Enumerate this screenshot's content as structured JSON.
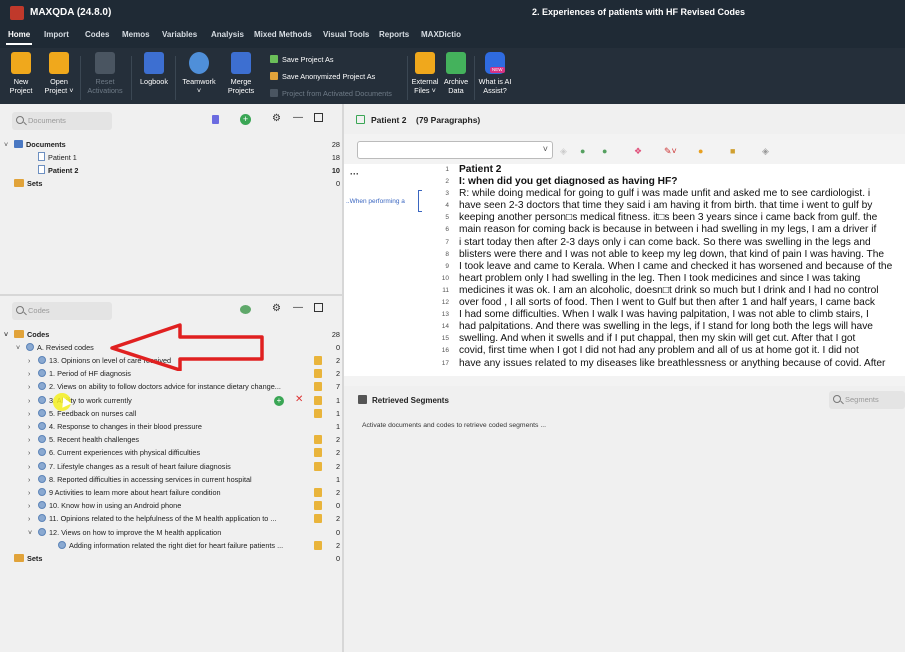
{
  "app_title": "MAXQDA (24.8.0)",
  "doc_title": "2. Experiences of patients with HF Revised Codes",
  "menu": [
    "Home",
    "Import",
    "Codes",
    "Memos",
    "Variables",
    "Analysis",
    "Mixed Methods",
    "Visual Tools",
    "Reports",
    "MAXDictio"
  ],
  "ribbon": {
    "new_project": [
      "New",
      "Project"
    ],
    "open_project": [
      "Open",
      "Project"
    ],
    "reset_activations": [
      "Reset",
      "Activations"
    ],
    "logbook": "Logbook",
    "teamwork": "Teamwork",
    "merge_projects": [
      "Merge",
      "Projects"
    ],
    "save_project_as": "Save Project As",
    "save_anonymized": "Save Anonymized Project As",
    "project_from_activated": "Project from Activated Documents",
    "external_files": [
      "External",
      "Files"
    ],
    "archive_data": [
      "Archive",
      "Data"
    ],
    "what_is_ai": [
      "What is AI",
      "Assist?"
    ],
    "new_badge": "NEW"
  },
  "documents_panel": {
    "search_placeholder": "Documents",
    "root_label": "Documents",
    "root_count": "28",
    "items": [
      {
        "label": "Patient 1",
        "count": "18"
      },
      {
        "label": "Patient 2",
        "count": "10"
      }
    ],
    "sets_label": "Sets",
    "sets_count": "0"
  },
  "codes_panel": {
    "search_placeholder": "Codes",
    "root_label": "Codes",
    "root_count": "28",
    "parent_label": "A. Revised codes",
    "parent_count": "0",
    "items": [
      {
        "label": "13. Opinions on level of care received",
        "count": "2"
      },
      {
        "label": "1. Period of HF diagnosis",
        "count": "2"
      },
      {
        "label": "2. Views on ability to follow doctors advice for instance dietary change...",
        "count": "7"
      },
      {
        "label": "3. Ability to work currently",
        "count": "1"
      },
      {
        "label": "5. Feedback on nurses call",
        "count": "1"
      },
      {
        "label": "4. Response to changes in their blood pressure",
        "count": "1"
      },
      {
        "label": "5.  Recent health challenges",
        "count": "2"
      },
      {
        "label": "6. Current experiences with physical difficulties",
        "count": "2"
      },
      {
        "label": "7. Lifestyle changes as a result of heart failure diagnosis",
        "count": "2"
      },
      {
        "label": "8. Reported difficulties in accessing services in current hospital",
        "count": "1"
      },
      {
        "label": "9 Activities to learn more about heart failure condition",
        "count": "2"
      },
      {
        "label": "10. Know how in using an Android phone",
        "count": "0"
      },
      {
        "label": "11. Opinions related to the helpfulness of the M health application to ...",
        "count": "2"
      },
      {
        "label": "12. Views on how to improve the M health application",
        "count": "0"
      },
      {
        "label": "Adding information related the right diet for heart failure patients ...",
        "count": "2"
      }
    ],
    "sets_label": "Sets",
    "sets_count": "0"
  },
  "browser": {
    "doc_name": "Patient 2",
    "paragraphs": "(79 Paragraphs)",
    "code_stripe_label": "..When performing a",
    "line_numbers": [
      "1",
      "2",
      "3",
      "4",
      "5",
      "6",
      "7",
      "8",
      "9",
      "10",
      "11",
      "12",
      "13",
      "14",
      "15",
      "16",
      "17"
    ],
    "lines": [
      "Patient 2",
      "I: when did you get diagnosed as having HF?",
      "R: while doing medical for going to gulf i was made unfit and asked me to see cardiologist. i",
      "have seen 2-3 doctors that time they said i am having it from birth. that time i went to gulf by",
      "keeping another person□s medical fitness. it□s been 3 years since i came back from gulf. the",
      "main reason for coming back is because in between i had swelling in my legs, I am a driver if",
      "i start today then after 2-3 days only i can come back. So there was swelling in the legs and",
      "blisters were there and I was not able to keep my leg down, that kind of pain I was having. The",
      "I took leave and came to Kerala. When I came and checked it has worsened and because of the",
      "heart problem only I had swelling in the leg. Then I took medicines and since I was taking",
      "medicines it was ok. I am an alcoholic, doesn□t drink so much but I drink and I had no control",
      "over food , I all sorts of food. Then I went to Gulf but then after 1 and half years, I came back",
      "I had some difficulties. When I walk I was having palpitation, I was not able to climb stairs, I",
      "had palpitations. And there was swelling in the legs, if I stand for long both the legs will have",
      "swelling. And when it swells and if I put chappal, then my skin will get cut. After that I got",
      "covid, first time when I got I did not had any problem and all of us at home got it. I did not",
      "have any issues related to my diseases like breathlessness or anything because of covid. After"
    ]
  },
  "retrieved": {
    "title": "Retrieved Segments",
    "search_placeholder": "Segments",
    "message": "Activate documents and codes to retrieve coded segments ..."
  },
  "colors": {
    "titlebar": "#1f2a35",
    "ribbon": "#252f3a",
    "arrow": "#e02020",
    "cursor_highlight": "#f5f020"
  }
}
